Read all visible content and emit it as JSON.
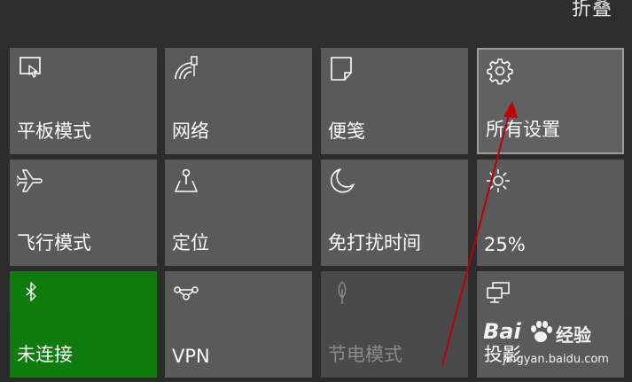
{
  "header": {
    "collapse_label": "折叠"
  },
  "tiles": [
    {
      "label": "平板模式",
      "icon": "tablet-mode-icon"
    },
    {
      "label": "网络",
      "icon": "network-icon"
    },
    {
      "label": "便笺",
      "icon": "note-icon"
    },
    {
      "label": "所有设置",
      "icon": "gear-icon"
    },
    {
      "label": "飞行模式",
      "icon": "airplane-icon"
    },
    {
      "label": "定位",
      "icon": "location-icon"
    },
    {
      "label": "免打扰时间",
      "icon": "moon-icon"
    },
    {
      "label": "25%",
      "icon": "brightness-icon"
    },
    {
      "label": "未连接",
      "icon": "bluetooth-icon"
    },
    {
      "label": "VPN",
      "icon": "vpn-icon"
    },
    {
      "label": "节电模式",
      "icon": "battery-saver-icon"
    },
    {
      "label": "投影",
      "icon": "project-icon"
    }
  ],
  "watermark": {
    "brand_main": "Bai",
    "brand_sub": "经验",
    "url": "jingyan.baidu.com"
  },
  "colors": {
    "tile": "#5a5a5a",
    "tile_active": "#107c10",
    "arrow": "#c00000"
  }
}
